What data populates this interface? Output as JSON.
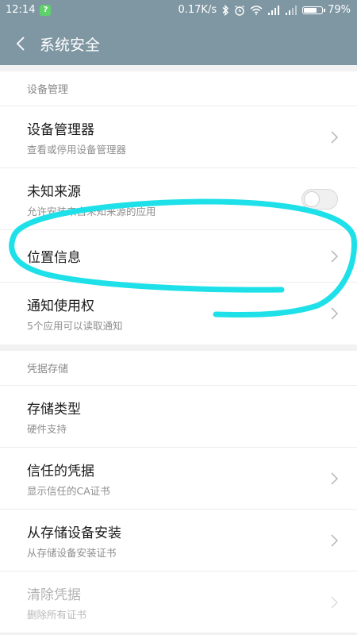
{
  "status_bar": {
    "time": "12:14",
    "notification_badge": "?",
    "network_speed": "0.17K/s",
    "battery_percent": "79%",
    "battery_level": 0.79,
    "icons": [
      "bluetooth-icon",
      "alarm-icon",
      "wifi-icon",
      "signal-icon",
      "signal-icon-2",
      "battery-icon"
    ]
  },
  "header": {
    "title": "系统安全",
    "back_icon": "back-arrow-icon"
  },
  "sections": {
    "device": {
      "header": "设备管理",
      "items": [
        {
          "title": "设备管理器",
          "subtitle": "查看或停用设备管理器",
          "control": "chevron"
        },
        {
          "title": "未知来源",
          "subtitle": "允许安装来自未知来源的应用",
          "control": "toggle",
          "toggle_on": false
        },
        {
          "title": "位置信息",
          "subtitle": "",
          "control": "chevron"
        },
        {
          "title": "通知使用权",
          "subtitle": "5个应用可以读取通知",
          "control": "chevron"
        }
      ]
    },
    "credentials": {
      "header": "凭据存储",
      "items": [
        {
          "title": "存储类型",
          "subtitle": "硬件支持",
          "control": "none"
        },
        {
          "title": "信任的凭据",
          "subtitle": "显示信任的CA证书",
          "control": "chevron"
        },
        {
          "title": "从存储设备安装",
          "subtitle": "从存储设备安装证书",
          "control": "chevron"
        },
        {
          "title": "清除凭据",
          "subtitle": "删除所有证书",
          "control": "chevron",
          "disabled": true
        }
      ]
    }
  },
  "colors": {
    "header_bg": "#7f97a3",
    "annotation": "#1ee0e8"
  }
}
